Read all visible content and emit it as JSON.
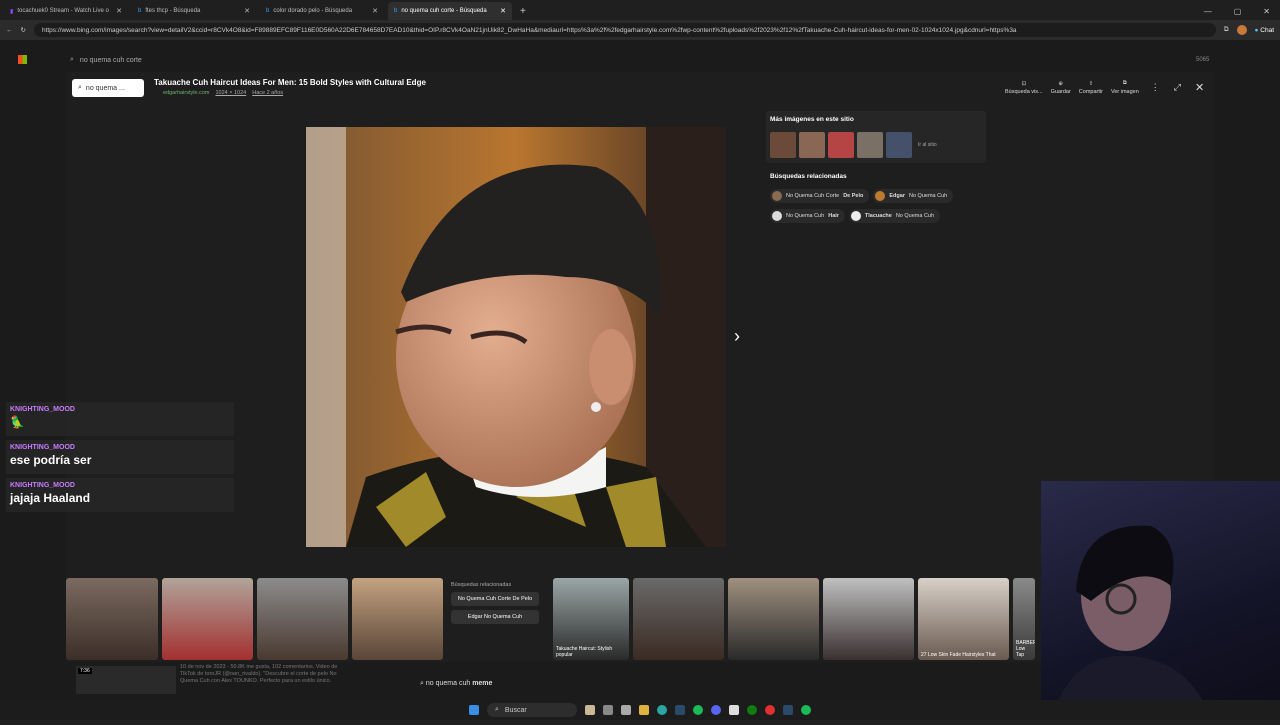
{
  "tabs": [
    {
      "label": "tocachuek0 Stream - Watch Live o"
    },
    {
      "label": "ftes thcp - Búsqueda"
    },
    {
      "label": "color dorado pelo - Búsqueda"
    },
    {
      "label": "no quema cuh corte - Búsqueda"
    }
  ],
  "address": "https://www.bing.com/images/search?view=detailV2&ccid=r8CVk4O8&id=F89889EFC89F116E0D560A22D6E784658D7EAD10&thid=OIP.r8CVk4OaN21jnUik82_DwHaHa&mediaurl=https%3a%2f%2fedgarhairstyle.com%2fwp-content%2fuploads%2f2023%2f12%2fTakuache-Cuh-haircut-ideas-for-men-02-1024x1024.jpg&cdnurl=https%3a",
  "browser_chat": "Chat",
  "bing": {
    "query": "no quema cuh corte",
    "points": "5065"
  },
  "modal": {
    "search_value": "no quema ...",
    "title": "Takuache Cuh Haircut Ideas For Men: 15 Bold Styles with Cultural Edge",
    "site": "edgarhairstyle.com",
    "size": "1024 × 1024",
    "age": "Hace 2 años",
    "tools": [
      "Búsqueda vis...",
      "Guardar",
      "Compartir",
      "Ver imagen"
    ],
    "more_title": "Más imágenes en este sitio",
    "more_label": "Ir al sitio",
    "related_title": "Búsquedas relacionadas",
    "related": [
      {
        "pre": "No Quema Cuh Corte ",
        "bold": "De Pelo"
      },
      {
        "pre": "Edgar ",
        "bold": "No Quema Cuh",
        "boldfirst": true
      },
      {
        "pre": "No Quema Cuh ",
        "bold": "Hair"
      },
      {
        "pre": "Tlacuache ",
        "bold": "No Quema Cuh",
        "boldfirst": true
      }
    ]
  },
  "strip": {
    "related_label": "Búsquedas relacionadas",
    "btn1": "No Quema Cuh Corte De Pelo",
    "btn2": "Edgar No Quema Cuh",
    "cap1": "Takuache Haircut: Stylish popular",
    "cap2": "27 Low Skin Fade Hairstyles That",
    "cap3": "BARBER Low Tap"
  },
  "chat": [
    {
      "user": "KNIGHTING_MOOD",
      "msg": "🦜"
    },
    {
      "user": "KNIGHTING_MOOD",
      "msg": "ese podría ser"
    },
    {
      "user": "KNIGHTING_MOOD",
      "msg": "jajaja Haaland"
    }
  ],
  "under": {
    "text": "10 de nov de 2023 · 50.8K me gusta, 102 comentarios. Video de TikTok de toroJR (@oan_rivaldo). \"Descubre el corte de pelo No Quema Cuh con Alex TOUNKO. Perfecto para un estilo único.",
    "time": "7:36",
    "query_pre": "no quema cuh ",
    "query_bold": "meme"
  },
  "taskbar": {
    "search": "Buscar"
  }
}
